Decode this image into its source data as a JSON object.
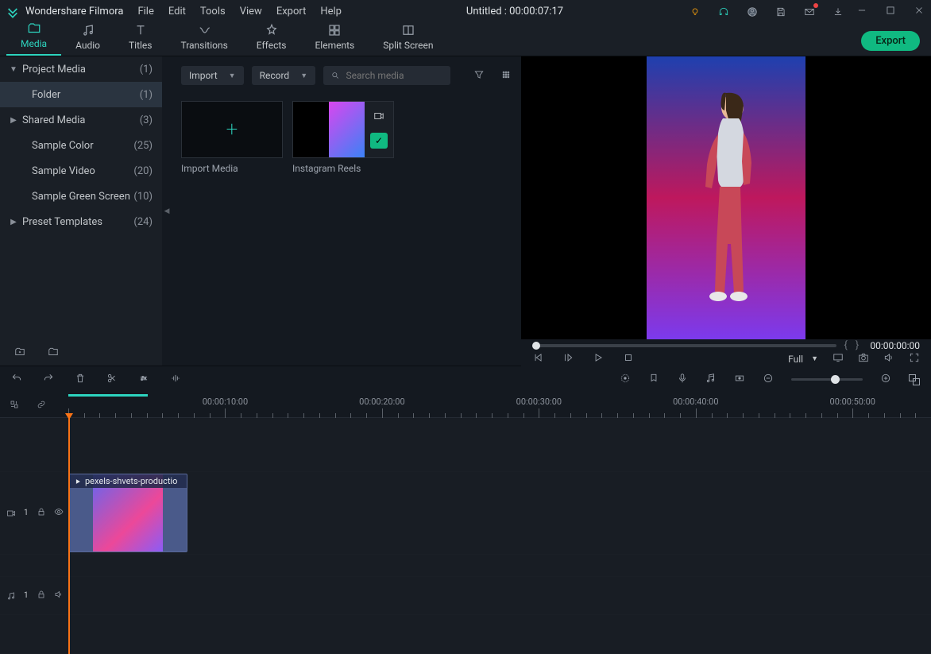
{
  "app": {
    "name": "Wondershare Filmora",
    "title": "Untitled : 00:00:07:17"
  },
  "menu": [
    "File",
    "Edit",
    "Tools",
    "View",
    "Export",
    "Help"
  ],
  "tabs": [
    {
      "label": "Media",
      "active": true
    },
    {
      "label": "Audio"
    },
    {
      "label": "Titles"
    },
    {
      "label": "Transitions"
    },
    {
      "label": "Effects"
    },
    {
      "label": "Elements"
    },
    {
      "label": "Split Screen"
    }
  ],
  "export_label": "Export",
  "sidebar": [
    {
      "label": "Project Media",
      "count": "(1)",
      "chev": "▼"
    },
    {
      "label": "Folder",
      "count": "(1)",
      "indent": true,
      "selected": true
    },
    {
      "label": "Shared Media",
      "count": "(3)",
      "chev": "▶"
    },
    {
      "label": "Sample Color",
      "count": "(25)",
      "indent": true
    },
    {
      "label": "Sample Video",
      "count": "(20)",
      "indent": true
    },
    {
      "label": "Sample Green Screen",
      "count": "(10)",
      "indent": true
    },
    {
      "label": "Preset Templates",
      "count": "(24)",
      "chev": "▶"
    }
  ],
  "media_panel": {
    "import": "Import",
    "record": "Record",
    "search_placeholder": "Search media",
    "thumb1": "Import Media",
    "thumb2": "Instagram Reels"
  },
  "preview": {
    "timecode": "00:00:00:00",
    "quality": "Full"
  },
  "ruler_labels": [
    "00:00:10:00",
    "00:00:20:00",
    "00:00:30:00",
    "00:00:40:00",
    "00:00:50:00"
  ],
  "track_video_number": "1",
  "track_audio_number": "1",
  "clip": {
    "name": "pexels-shvets-productio"
  }
}
